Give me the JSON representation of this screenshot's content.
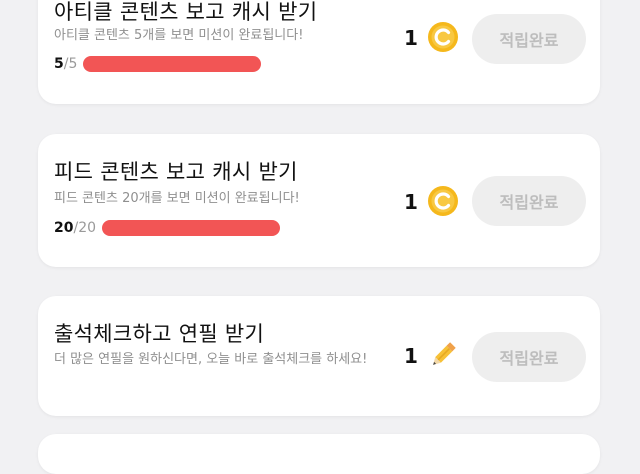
{
  "missions": [
    {
      "title": "아티클 콘텐츠 보고 캐시 받기",
      "description": "아티클 콘텐츠 5개를 보면 미션이 완료됩니다!",
      "progress_current": "5",
      "progress_total": "/5",
      "progress_fraction": 1.0,
      "reward_count": "1",
      "reward_icon": "coin-icon",
      "button_label": "적립완료"
    },
    {
      "title": "피드 콘텐츠 보고 캐시 받기",
      "description": "피드 콘텐츠 20개를 보면 미션이 완료됩니다!",
      "progress_current": "20",
      "progress_total": "/20",
      "progress_fraction": 1.0,
      "reward_count": "1",
      "reward_icon": "coin-icon",
      "button_label": "적립완료"
    },
    {
      "title": "출석체크하고 연필 받기",
      "description": "더 많은 연필을 원하신다면, 오늘 바로 출석체크를 하세요!",
      "reward_count": "1",
      "reward_icon": "pencil-icon",
      "button_label": "적립완료"
    }
  ],
  "colors": {
    "progress_bar": "#f25555",
    "coin": "#f5b81c",
    "button_disabled_bg": "#eeeeee",
    "button_disabled_text": "#bdbdbd"
  }
}
